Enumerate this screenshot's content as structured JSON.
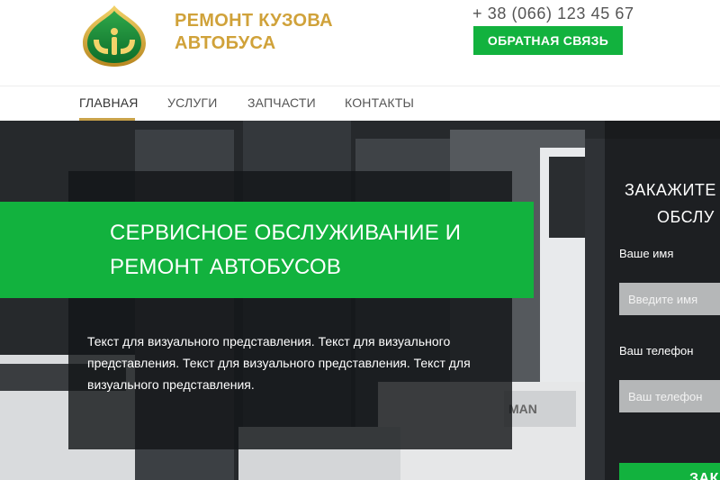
{
  "header": {
    "brand_line1": "РЕМОНТ КУЗОВА",
    "brand_line2": "АВТОБУСА",
    "logo_icon": "bus-company-logo-icon",
    "phone": "+ 38 (066) 123 45 67",
    "callback_label": "ОБРАТНАЯ СВЯЗЬ"
  },
  "nav": {
    "items": [
      {
        "label": "ГЛАВНАЯ",
        "active": true
      },
      {
        "label": "УСЛУГИ",
        "active": false
      },
      {
        "label": "ЗАПЧАСТИ",
        "active": false
      },
      {
        "label": "КОНТАКТЫ",
        "active": false
      }
    ]
  },
  "hero": {
    "title": "СЕРВИСНОЕ ОБСЛУЖИВАНИЕ И РЕМОНТ АВТОБУСОВ",
    "text": "Текст для визуального представления. Текст для визуального представления. Текст для визуального представления. Текст для визуального представления."
  },
  "form": {
    "title_line1": "ЗАКАЖИТЕ",
    "title_line2": "ОБСЛУ",
    "name_label": "Ваше имя",
    "name_placeholder": "Введите имя",
    "phone_label": "Ваш телефон",
    "phone_placeholder": "Ваш телефон",
    "submit_label": "ЗАКА"
  },
  "colors": {
    "accent_green": "#12b23e",
    "brand_gold": "#d0a23a",
    "nav_underline": "#c9a24a"
  }
}
